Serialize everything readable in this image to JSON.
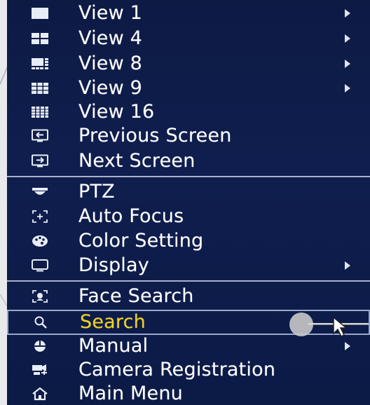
{
  "colors": {
    "menu_bg": "#0f1e4e",
    "text": "#ffffff",
    "selected_text": "#f2d21a",
    "divider": "#a8b1c9",
    "selection_border": "#9aa9cf"
  },
  "groups": [
    {
      "items": [
        {
          "label": "View 1",
          "icon": "single-pane-icon",
          "submenu": true
        },
        {
          "label": "View 4",
          "icon": "quad-grid-icon",
          "submenu": true
        },
        {
          "label": "View 8",
          "icon": "eight-grid-icon",
          "submenu": true
        },
        {
          "label": "View 9",
          "icon": "nine-grid-icon",
          "submenu": true
        },
        {
          "label": "View 16",
          "icon": "sixteen-grid-icon",
          "submenu": false
        },
        {
          "label": "Previous Screen",
          "icon": "previous-screen-icon",
          "submenu": false
        },
        {
          "label": "Next Screen",
          "icon": "next-screen-icon",
          "submenu": false
        }
      ]
    },
    {
      "items": [
        {
          "label": "PTZ",
          "icon": "ptz-dome-icon",
          "submenu": false
        },
        {
          "label": "Auto Focus",
          "icon": "auto-focus-icon",
          "submenu": false
        },
        {
          "label": "Color Setting",
          "icon": "palette-icon",
          "submenu": false
        },
        {
          "label": "Display",
          "icon": "monitor-icon",
          "submenu": true
        }
      ]
    },
    {
      "items": [
        {
          "label": "Face Search",
          "icon": "face-search-icon",
          "submenu": false
        },
        {
          "label": "Search",
          "icon": "search-icon",
          "submenu": false,
          "selected": true
        },
        {
          "label": "Manual",
          "icon": "manual-icon",
          "submenu": true
        },
        {
          "label": "Camera Registration",
          "icon": "camera-registration-icon",
          "submenu": false
        },
        {
          "label": "Main Menu",
          "icon": "home-icon",
          "submenu": false
        }
      ]
    }
  ]
}
